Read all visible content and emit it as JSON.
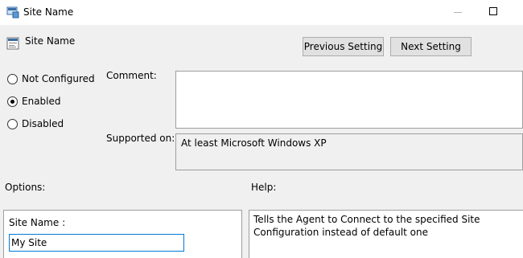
{
  "window": {
    "title": "Site Name",
    "icon": "policy-window-icon"
  },
  "header": {
    "setting_name": "Site Name",
    "icon": "policy-setting-icon"
  },
  "nav": {
    "previous_label": "Previous Setting",
    "next_label": "Next Setting"
  },
  "state": {
    "options": [
      {
        "label": "Not Configured",
        "checked": false
      },
      {
        "label": "Enabled",
        "checked": true
      },
      {
        "label": "Disabled",
        "checked": false
      }
    ]
  },
  "comment": {
    "label": "Comment:",
    "value": ""
  },
  "supported": {
    "label": "Supported on:",
    "value": "At least Microsoft Windows XP"
  },
  "options_section": {
    "label": "Options:",
    "site_name_label": "Site Name :",
    "site_name_value": "My Site"
  },
  "help_section": {
    "label": "Help:",
    "text": "Tells the Agent to Connect to the specified Site Configuration instead of default one"
  },
  "colors": {
    "background": "#f0f0f0",
    "focus_border": "#0078d7",
    "button_face": "#e1e1e1"
  }
}
